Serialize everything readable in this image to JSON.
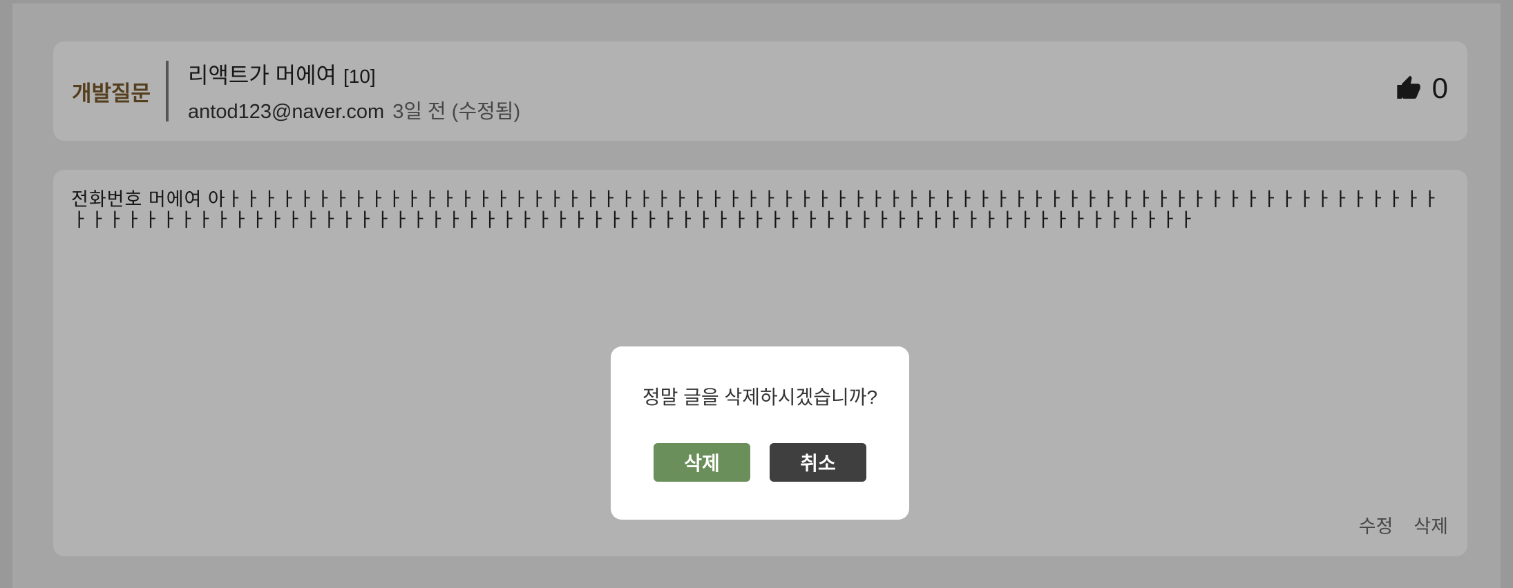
{
  "post": {
    "category": "개발질문",
    "title": "리액트가 머에여",
    "comment_count": "[10]",
    "author": "antod123@naver.com",
    "time": "3일 전 (수정됨)",
    "like_count": "0",
    "body": "전화번호 머에여 아ㅏㅏㅏㅏㅏㅏㅏㅏㅏㅏㅏㅏㅏㅏㅏㅏㅏㅏㅏㅏㅏㅏㅏㅏㅏㅏㅏㅏㅏㅏㅏㅏㅏㅏㅏㅏㅏㅏㅏㅏㅏㅏㅏㅏㅏㅏㅏㅏㅏㅏㅏㅏㅏㅏㅏㅏㅏㅏㅏㅏㅏㅏㅏㅏㅏㅏㅏㅏㅏㅏㅏㅏㅏㅏㅏㅏㅏㅏㅏㅏㅏㅏㅏㅏㅏㅏㅏㅏㅏㅏㅏㅏㅏㅏㅏㅏㅏㅏㅏㅏㅏㅏㅏㅏㅏㅏㅏㅏㅏㅏㅏㅏㅏㅏㅏㅏㅏㅏㅏㅏㅏㅏㅏㅏㅏㅏㅏㅏㅏㅏㅏ",
    "edit_label": "수정",
    "delete_label": "삭제"
  },
  "modal": {
    "message": "정말 글을 삭제하시겠습니까?",
    "confirm_label": "삭제",
    "cancel_label": "취소"
  },
  "icons": {
    "like": "thumbs-up-icon"
  },
  "colors": {
    "category": "#7a5a2a",
    "confirm_button": "#6b8f5b",
    "cancel_button": "#3f3f3f"
  }
}
